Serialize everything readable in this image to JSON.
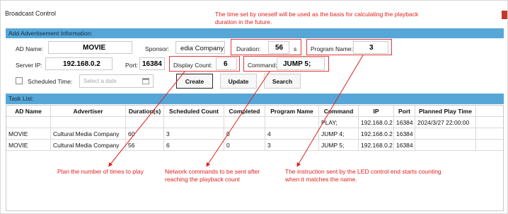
{
  "window": {
    "title": "Broadcast Control"
  },
  "annotations": {
    "top_note": "The time set by oneself will be used as the basis for calculating the playback duration in the future.",
    "plan_note": "Plan the number of times to play",
    "network_note": "Network commands to be sent after reaching the playback count",
    "led_note": "The instruction sent by the LED control end starts counting when it matches the name."
  },
  "form": {
    "section_title": "Add Advertisement Information:",
    "ad_name_label": "AD Name:",
    "ad_name_value": "MOVIE",
    "sponsor_label": "Sponsor:",
    "sponsor_value": "edia Company",
    "duration_label": "Duration:",
    "duration_value": "56",
    "duration_unit": "s",
    "program_label": "Program Name:",
    "program_value": "3",
    "server_label": "Server IP:",
    "server_value": "192.168.0.2",
    "port_label": "Port:",
    "port_value": "16384",
    "display_count_label": "Display Count:",
    "display_count_value": "6",
    "command_label": "Command:",
    "command_value": "JUMP 5;",
    "scheduled_label": "Scheduled Time:",
    "scheduled_placeholder": "Select a date",
    "create_label": "Create",
    "update_label": "Update",
    "search_label": "Search"
  },
  "tasks": {
    "section_title": "Task List:",
    "columns": [
      "AD Name",
      "Advertiser",
      "Duration(s)",
      "Scheduled Count",
      "Completed",
      "Program Name",
      "Command",
      "IP",
      "Port",
      "Planned Play Time"
    ],
    "rows": [
      [
        "",
        "",
        "",
        "",
        "",
        "",
        "PLAY;",
        "192.168.0.2",
        "16384",
        "2024/3/27 22:00:00"
      ],
      [
        "MOVIE",
        "Cultural Media Company",
        "60",
        "3",
        "0",
        "4",
        "JUMP 4;",
        "192.168.0.2",
        "16384",
        ""
      ],
      [
        "MOVIE",
        "Cultural Media Company",
        "56",
        "6",
        "0",
        "3",
        "JUMP 5;",
        "192.168.0.2",
        "16384",
        ""
      ]
    ]
  },
  "colors": {
    "header_blue": "#56a6d8",
    "annotation_red": "#e02020"
  },
  "icons": {
    "calendar": "calendar-icon",
    "close": "close-mark"
  }
}
